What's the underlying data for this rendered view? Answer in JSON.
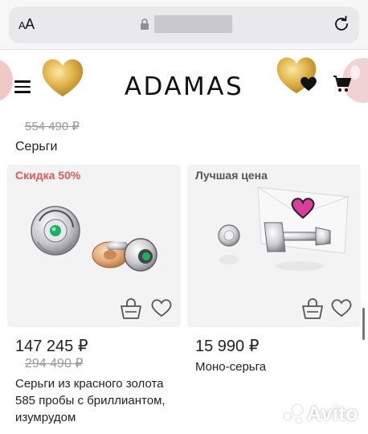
{
  "browser": {
    "text_size_label": "AA",
    "lock_icon": "lock-icon",
    "reload_icon": "reload-icon"
  },
  "header": {
    "logo": "ADAMAS",
    "menu_icon": "hamburger-menu-icon",
    "wishlist_icon": "heart-icon",
    "cart_icon": "cart-icon"
  },
  "previous_product": {
    "old_price": "554 490 ₽",
    "name": "Серьги"
  },
  "products": [
    {
      "badge": "Скидка 50%",
      "badge_color": "#e05a5a",
      "price": "147 245 ₽",
      "old_price": "294 490 ₽",
      "name_line1": "Серьги из красного золота",
      "name_line2": "585 пробы с бриллиантом,",
      "name_line3": "изумрудом"
    },
    {
      "badge": "Лучшая цена",
      "badge_color": "#555555",
      "price": "15 990 ₽",
      "name_line1": "Моно-серьга"
    }
  ],
  "watermark": "Avito"
}
